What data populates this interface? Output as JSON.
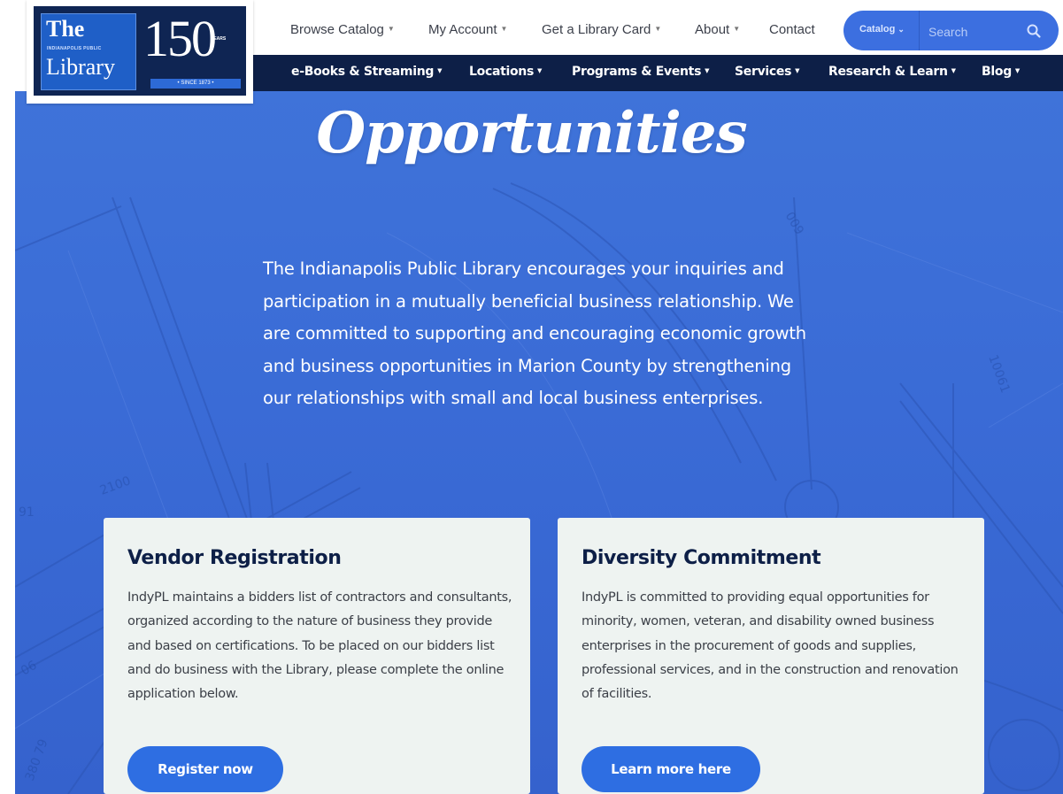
{
  "logo": {
    "the": "The",
    "sub": "INDIANAPOLIS PUBLIC",
    "library": "Library",
    "anniversary": "150",
    "years": "YEARS",
    "since": "• SINCE 1873 •"
  },
  "utility_nav": {
    "items": [
      {
        "label": "Browse Catalog",
        "dropdown": true
      },
      {
        "label": "My Account",
        "dropdown": true
      },
      {
        "label": "Get a Library Card",
        "dropdown": true
      },
      {
        "label": "About",
        "dropdown": true
      },
      {
        "label": "Contact",
        "dropdown": false
      }
    ]
  },
  "search": {
    "scope_label": "Catalog",
    "placeholder": "Search"
  },
  "main_nav": {
    "items": [
      {
        "label": "e-Books & Streaming"
      },
      {
        "label": "Locations"
      },
      {
        "label": "Programs & Events"
      },
      {
        "label": "Services"
      },
      {
        "label": "Research & Learn"
      },
      {
        "label": "Blog"
      }
    ]
  },
  "hero": {
    "title": "Opportunities",
    "text": "The Indianapolis Public Library encourages your inquiries and participation in a mutually beneficial business relationship. We are committed to supporting and encouraging economic growth and business opportunities in Marion County by strengthening our relationships with small and local business enterprises."
  },
  "cards": [
    {
      "title": "Vendor Registration",
      "body": "IndyPL maintains a bidders list of contractors and consultants, organized according to the nature of business they provide and based on certifications. To be placed on our bidders list and do business with the Library, please complete the online application below.",
      "button": "Register now"
    },
    {
      "title": "Diversity Commitment",
      "body": "IndyPL is committed to providing equal opportunities for minority, women, veteran, and disability owned business enterprises in the procurement of goods and supplies, professional services, and in the construction and renovation of facilities.",
      "button": "Learn more here"
    }
  ],
  "blueprint_labels": {
    "a": "2100",
    "b": "009",
    "c": "10061",
    "d": "380 79",
    "e": "91",
    "f": "06"
  },
  "colors": {
    "hero_blue": "#3b6cd6",
    "nav_navy": "#0d1f47",
    "button_blue": "#2e6ee2",
    "card_bg": "#eef3f1"
  }
}
